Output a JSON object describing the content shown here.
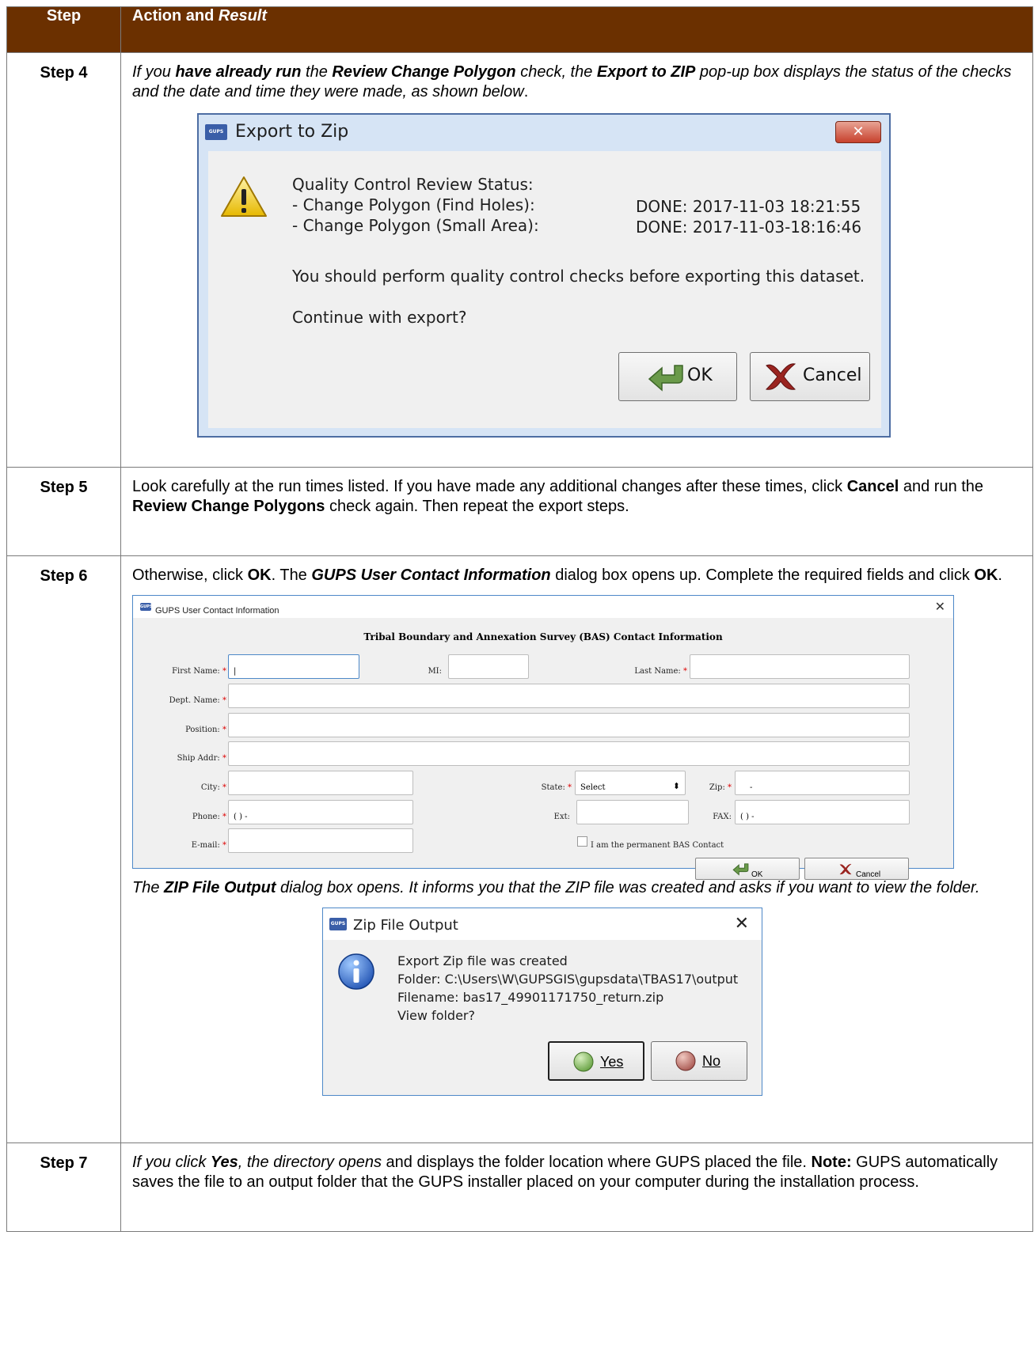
{
  "table": {
    "header_step": "Step",
    "header_action": "Action and ",
    "header_result": "Result"
  },
  "step4": {
    "label": "Step 4",
    "t1": "If you ",
    "t2": "have already run",
    "t3": " the ",
    "t4": "Review Change Polygon",
    "t5": " check, the ",
    "t6": "Export to ZIP",
    "t7": " pop-up box displays the status of the checks and the date and time they were made, as shown below",
    "t8": "."
  },
  "export_dialog": {
    "title": "Export to Zip",
    "status_heading": "Quality Control Review Status:",
    "item1": " - Change Polygon (Find Holes):",
    "item1_value": "DONE:  2017-11-03 18:21:55",
    "item2": " - Change Polygon (Small Area):",
    "item2_value": "DONE:  2017-11-03-18:16:46",
    "message": "You should perform quality control checks before exporting this dataset.",
    "question": "Continue with export?",
    "ok_label": "OK",
    "cancel_label": "Cancel",
    "logo_text": "GUPS"
  },
  "step5": {
    "label": "Step 5",
    "t1": "Look carefully at the run times listed. If you have made any additional changes after these times, click ",
    "t2": "Cancel",
    "t3": " and run the ",
    "t4": "Review Change Polygons",
    "t5": " check again. Then repeat the export steps."
  },
  "step6": {
    "label": "Step 6",
    "t1": "Otherwise, click ",
    "t2": "OK",
    "t3": ". The ",
    "t4": "GUPS User Contact Information",
    "t5": " dialog box opens up. Complete the required fields and click ",
    "t6": "OK",
    "t7": ".",
    "after1": "The ",
    "after2": "ZIP File Output",
    "after3": " dialog box opens. It informs you that the ZIP file was created and asks if you want to view the folder."
  },
  "contact_dialog": {
    "title": "GUPS User Contact Information",
    "heading": "Tribal Boundary and Annexation Survey (BAS) Contact Information",
    "first_name_label": "First Name:",
    "mi_label": "MI:",
    "last_name_label": "Last Name:",
    "dept_label": "Dept. Name:",
    "position_label": "Position:",
    "ship_label": "Ship Addr:",
    "city_label": "City:",
    "state_label": "State:",
    "state_value": "Select",
    "zip_label": "Zip:",
    "zip_value": "-",
    "phone_label": "Phone:",
    "phone_value": "(  )   -",
    "ext_label": "Ext:",
    "fax_label": "FAX:",
    "fax_value": "(  )   -",
    "email_label": "E-mail:",
    "permanent_label": "I am the permanent BAS Contact",
    "ok_label": "OK",
    "cancel_label": "Cancel",
    "req_mark": "*"
  },
  "zip_dialog": {
    "title": "Zip File Output",
    "line1": "Export Zip file was created",
    "line2": "Folder: C:\\Users\\W\\GUPSGIS\\gupsdata\\TBAS17\\output",
    "line3": "Filename: bas17_49901171750_return.zip",
    "line4": "View folder?",
    "yes_label": "Yes",
    "no_label": "No"
  },
  "step7": {
    "label": "Step 7",
    "t1": "If you click ",
    "t2": "Yes",
    "t3": ", the directory opens",
    "t4": " and displays the folder location where GUPS placed the file. ",
    "t5": "Note:",
    "t6": "  GUPS automatically saves the file to an output folder that the GUPS installer placed on your computer during the installation process."
  },
  "colors": {
    "header_bg": "#6b3000",
    "header_text": "#ffffff",
    "required": "#dd0000",
    "dialog_border": "#4d88c8"
  },
  "icons": [
    "warning-icon",
    "info-icon",
    "gups-logo",
    "ok-arrow-icon",
    "cancel-x-icon",
    "close-icon",
    "yes-icon",
    "no-icon"
  ]
}
